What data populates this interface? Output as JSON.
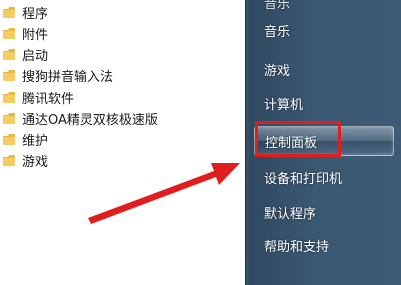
{
  "programs": [
    {
      "label": "程序"
    },
    {
      "label": "附件"
    },
    {
      "label": "启动"
    },
    {
      "label": "搜狗拼音输入法"
    },
    {
      "label": "腾讯软件"
    },
    {
      "label": "通达OA精灵双核极速版"
    },
    {
      "label": "维护"
    },
    {
      "label": "游戏"
    }
  ],
  "right_menu": {
    "partial_top": "音乐",
    "items": [
      {
        "label": "音乐"
      },
      {
        "label": "游戏"
      },
      {
        "label": "计算机"
      },
      {
        "label": "控制面板"
      },
      {
        "label": "设备和打印机"
      },
      {
        "label": "默认程序"
      },
      {
        "label": "帮助和支持"
      }
    ],
    "highlighted": "控制面板"
  },
  "colors": {
    "folder": "#e8b84a",
    "annotation": "#e11e1e",
    "right_pane": "#3b5872"
  }
}
